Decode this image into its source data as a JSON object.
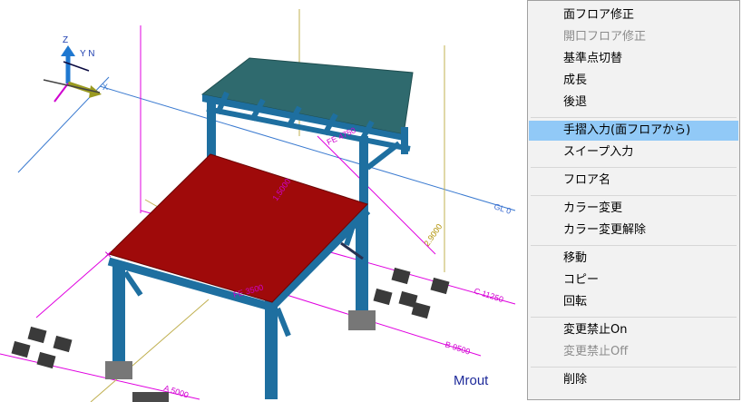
{
  "viewport": {
    "status_text": "Mrout",
    "axis_labels": {
      "z": "Z",
      "y": "Y N",
      "x": "X"
    },
    "grid_labels": [
      "GL 0",
      "C 11250",
      "B 9500",
      "A 5000"
    ],
    "dimension_labels": [
      "FE 4750",
      "1.5000",
      "2.9000",
      "FE 3500"
    ],
    "colors": {
      "steel": "#1e6fa0",
      "floor_red": "#9f0a0a",
      "roof_teal": "#2f6a6e",
      "grid_magenta": "#e000e0",
      "grid_blue": "#3a7ad0",
      "grid_olive": "#c0b050"
    }
  },
  "context_menu": {
    "items": [
      {
        "label": "面フロア修正",
        "enabled": true,
        "highlighted": false
      },
      {
        "label": "開口フロア修正",
        "enabled": false,
        "highlighted": false
      },
      {
        "label": "基準点切替",
        "enabled": true,
        "highlighted": false
      },
      {
        "label": "成長",
        "enabled": true,
        "highlighted": false
      },
      {
        "label": "後退",
        "enabled": true,
        "highlighted": false
      },
      {
        "separator": true
      },
      {
        "label": "手摺入力(面フロアから)",
        "enabled": true,
        "highlighted": true
      },
      {
        "label": "スイープ入力",
        "enabled": true,
        "highlighted": false
      },
      {
        "separator": true
      },
      {
        "label": "フロア名",
        "enabled": true,
        "highlighted": false
      },
      {
        "separator": true
      },
      {
        "label": "カラー変更",
        "enabled": true,
        "highlighted": false
      },
      {
        "label": "カラー変更解除",
        "enabled": true,
        "highlighted": false
      },
      {
        "separator": true
      },
      {
        "label": "移動",
        "enabled": true,
        "highlighted": false
      },
      {
        "label": "コピー",
        "enabled": true,
        "highlighted": false
      },
      {
        "label": "回転",
        "enabled": true,
        "highlighted": false
      },
      {
        "separator": true
      },
      {
        "label": "変更禁止On",
        "enabled": true,
        "highlighted": false
      },
      {
        "label": "変更禁止Off",
        "enabled": false,
        "highlighted": false
      },
      {
        "separator": true
      },
      {
        "label": "削除",
        "enabled": true,
        "highlighted": false
      }
    ]
  }
}
